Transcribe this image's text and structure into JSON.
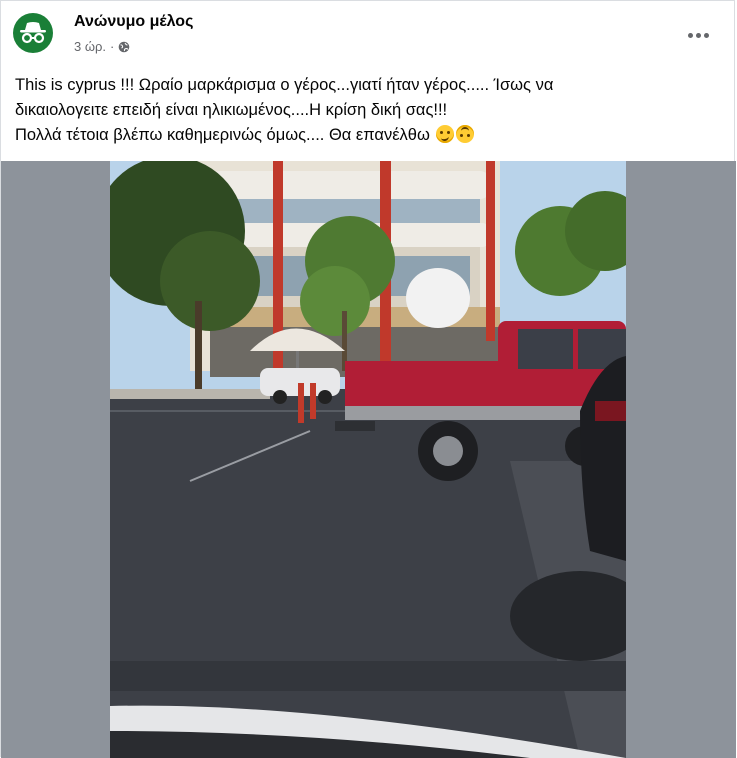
{
  "post": {
    "author": "Ανώνυμο μέλος",
    "time": "3 ώρ.",
    "separator": "·",
    "audience_icon": "public-globe-icon",
    "menu_icon": "more-options-icon",
    "text_line1": "This is cyprus !!! Ωραίο μαρκάρισμα ο γέρος...γιατί ήταν γέρος..... Ίσως να",
    "text_line2": "δικαιολογειτε επειδή είναι ηλικιωμένος....Η κρίση δική σας!!!",
    "text_line3": "Πολλά τέτοια βλέπω καθημερινώς όμως.... Θα επανέλθω",
    "emojis": [
      "smirk-emoji",
      "upside-down-face-emoji"
    ]
  },
  "colors": {
    "avatar_bg": "#1a7f37",
    "media_letterbox": "#8d939b",
    "truck_red": "#b11e36"
  }
}
